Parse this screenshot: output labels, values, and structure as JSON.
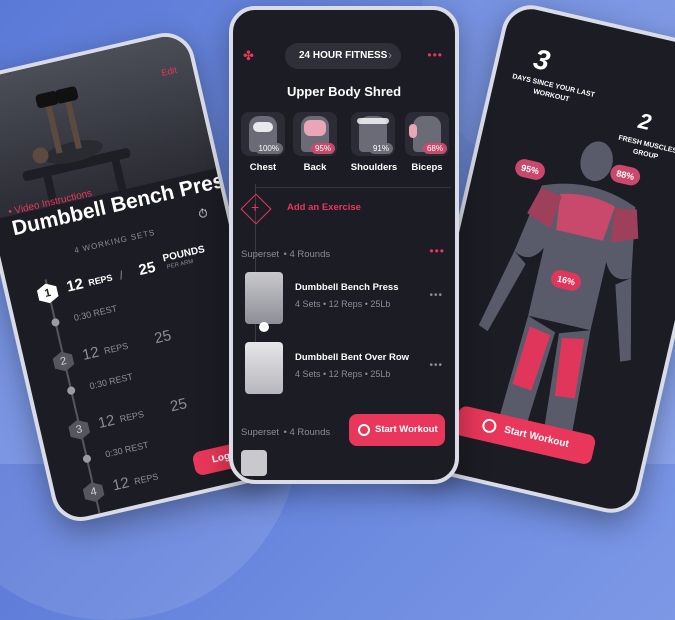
{
  "left_phone": {
    "video_link": "• Video Instructions",
    "title": "Dumbbell Bench Press",
    "working_sets": "4 WORKING SETS",
    "sets": [
      {
        "num": "1",
        "reps": "12",
        "reps_label": "REPS",
        "sep": "/",
        "weight": "25",
        "weight_label": "POUNDS",
        "weight_sub": "PER ARM"
      },
      {
        "num": "2",
        "reps": "12",
        "reps_label": "REPS",
        "weight": "25"
      },
      {
        "num": "3",
        "reps": "12",
        "reps_label": "REPS",
        "weight": "25"
      },
      {
        "num": "4",
        "reps": "12",
        "reps_label": "REPS",
        "weight": ""
      }
    ],
    "rest": "0:30 REST",
    "log_set": "Log Set"
  },
  "mid_phone": {
    "gym": "24 HOUR FITNESS",
    "workout_title": "Upper Body Shred",
    "muscles": [
      {
        "name": "Chest",
        "pct": "100%",
        "color": "#6a6b77"
      },
      {
        "name": "Back",
        "pct": "95%",
        "color": "#c84a6a"
      },
      {
        "name": "Shoulders",
        "pct": "91%",
        "color": "#6a6b77"
      },
      {
        "name": "Biceps",
        "pct": "68%",
        "color": "#c84a6a"
      }
    ],
    "add_exercise": "Add an Exercise",
    "superset_label": "Superset",
    "superset_rounds": "4 Rounds",
    "exercises": [
      {
        "name": "Dumbbell Bench Press",
        "detail": "4 Sets • 12 Reps • 25Lb"
      },
      {
        "name": "Dumbbell Bent Over Row",
        "detail": "4 Sets • 12 Reps • 25Lb"
      }
    ],
    "superset2_label": "Superset",
    "superset2_rounds": "4 Rounds",
    "start_workout": "Start Workout",
    "accent": "#e8375a"
  },
  "right_phone": {
    "days_num": "3",
    "days_label": "DAYS SINCE YOUR LAST WORKOUT",
    "fresh_num": "2",
    "fresh_label": "FRESH MUSCLES GROUP",
    "badge_left": "95%",
    "badge_right": "88%",
    "badge_legs": "16%",
    "start_workout": "Start Workout"
  }
}
